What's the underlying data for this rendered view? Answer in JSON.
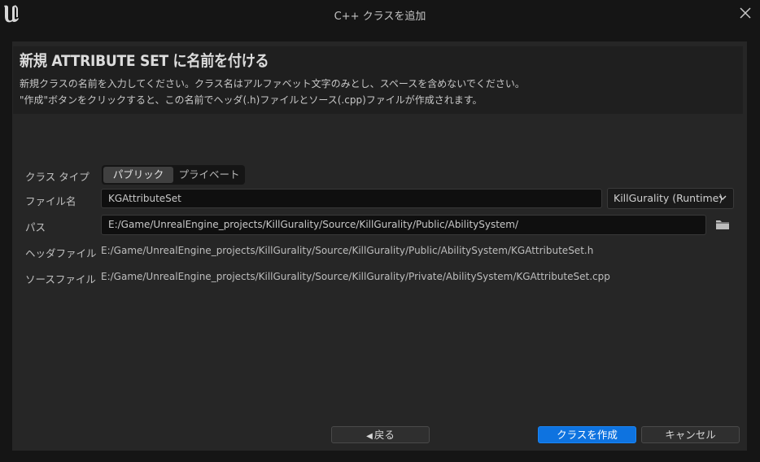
{
  "window": {
    "title": "C++ クラスを追加",
    "logo_icon": "unreal-engine-logo",
    "close_icon": "close-icon"
  },
  "header": {
    "title": "新規 ATTRIBUTE SET に名前を付ける",
    "description_line1": "新規クラスの名前を入力してください。クラス名はアルファベット文字のみとし、スペースを含めないでください。",
    "description_line2": "\"作成\"ボタンをクリックすると、この名前でヘッダ(.h)ファイルとソース(.cpp)ファイルが作成されます。"
  },
  "form": {
    "class_type": {
      "label": "クラス タイプ",
      "options": [
        "パブリック",
        "プライベート"
      ],
      "selected": "パブリック"
    },
    "file_name": {
      "label": "ファイル名",
      "value": "KGAttributeSet"
    },
    "module": {
      "value": "KillGurality (Runtime)"
    },
    "path": {
      "label": "パス",
      "value": "E:/Game/UnrealEngine_projects/KillGurality/Source/KillGurality/Public/AbilitySystem/",
      "browse_icon": "folder-icon"
    },
    "header_file": {
      "label": "ヘッダファイル",
      "value": "E:/Game/UnrealEngine_projects/KillGurality/Source/KillGurality/Public/AbilitySystem/KGAttributeSet.h"
    },
    "source_file": {
      "label": "ソースファイル",
      "value": "E:/Game/UnrealEngine_projects/KillGurality/Source/KillGurality/Private/AbilitySystem/KGAttributeSet.cpp"
    }
  },
  "footer": {
    "back_label": "戻る",
    "create_label": "クラスを作成",
    "cancel_label": "キャンセル"
  },
  "colors": {
    "background": "#151515",
    "panel": "#262626",
    "primary_button": "#0e73e0"
  }
}
